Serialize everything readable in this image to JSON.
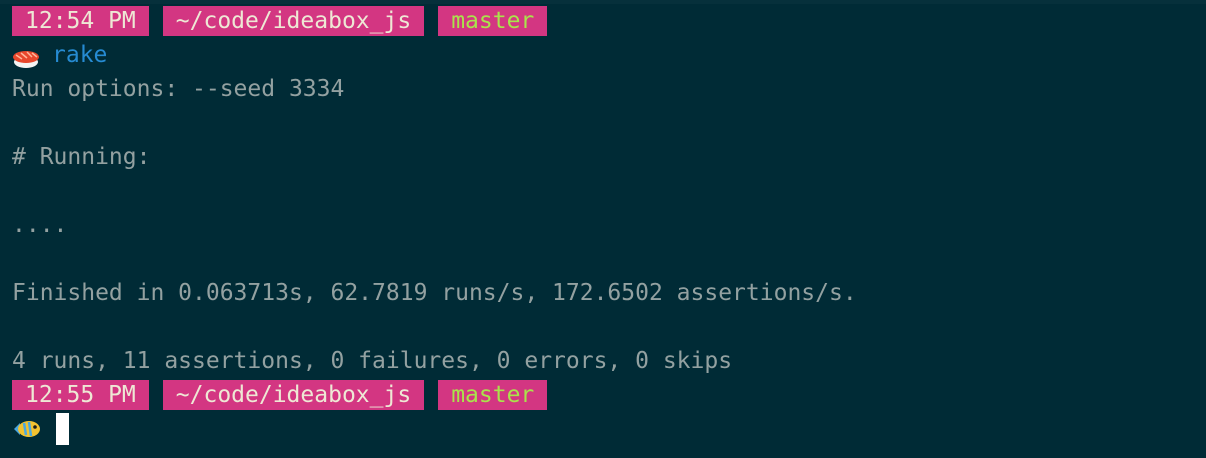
{
  "prompt1": {
    "time": "12:54 PM",
    "path": "~/code/ideabox_js",
    "branch": "master"
  },
  "command": "rake",
  "output": [
    "Run options: --seed 3334",
    "",
    "# Running:",
    "",
    "....",
    "",
    "Finished in 0.063713s, 62.7819 runs/s, 172.6502 assertions/s.",
    "",
    "4 runs, 11 assertions, 0 failures, 0 errors, 0 skips"
  ],
  "prompt2": {
    "time": "12:55 PM",
    "path": "~/code/ideabox_js",
    "branch": "master"
  },
  "icons": {
    "prompt1_icon": "sushi-icon",
    "prompt2_icon": "fish-icon"
  },
  "colors": {
    "background": "#002b36",
    "segment": "#d33682",
    "branch_text": "#a9e34b",
    "command": "#268bd2",
    "output_text": "#93a1a1"
  }
}
